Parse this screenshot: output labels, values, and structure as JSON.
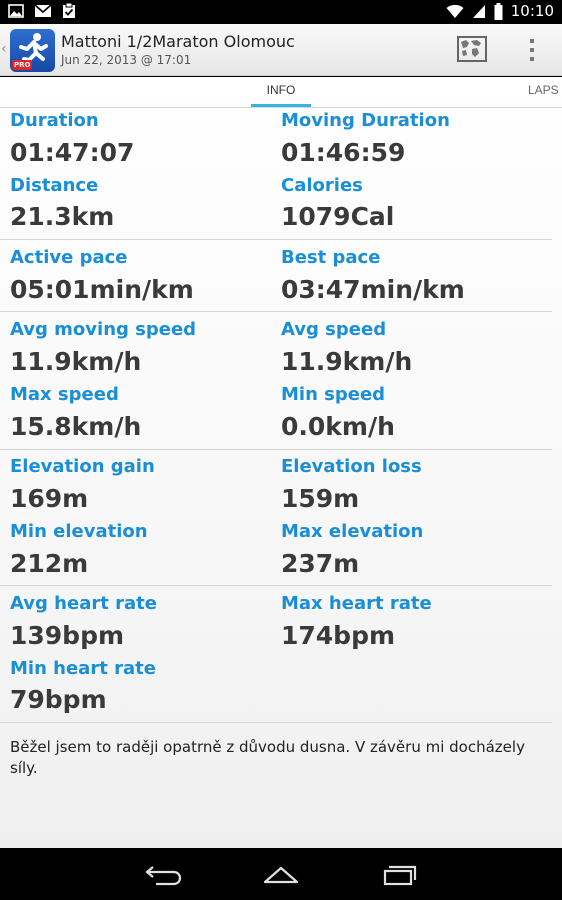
{
  "status_bar": {
    "time": "10:10",
    "left_icons": [
      "image-icon",
      "gmail-icon",
      "clipboard-icon"
    ],
    "right_icons": [
      "wifi-icon",
      "signal-icon",
      "battery-icon"
    ]
  },
  "action_bar": {
    "title": "Mattoni 1/2Maraton Olomouc",
    "subtitle": "Jun 22, 2013 @ 17:01",
    "logo_badge": "PRO",
    "actions": [
      "map-icon",
      "overflow-menu-icon"
    ]
  },
  "tabs": [
    {
      "label": "INFO",
      "selected": true
    },
    {
      "label": "LAPS",
      "selected": false
    }
  ],
  "stats": {
    "duration": {
      "label": "Duration",
      "value": "01:47:07"
    },
    "moving_duration": {
      "label": "Moving Duration",
      "value": "01:46:59"
    },
    "distance": {
      "label": "Distance",
      "value": "21.3km"
    },
    "calories": {
      "label": "Calories",
      "value": "1079Cal"
    },
    "active_pace": {
      "label": "Active pace",
      "value": "05:01min/km"
    },
    "best_pace": {
      "label": "Best pace",
      "value": "03:47min/km"
    },
    "avg_moving_speed": {
      "label": "Avg moving speed",
      "value": "11.9km/h"
    },
    "avg_speed": {
      "label": "Avg speed",
      "value": "11.9km/h"
    },
    "max_speed": {
      "label": "Max speed",
      "value": "15.8km/h"
    },
    "min_speed": {
      "label": "Min speed",
      "value": "0.0km/h"
    },
    "elevation_gain": {
      "label": "Elevation gain",
      "value": "169m"
    },
    "elevation_loss": {
      "label": "Elevation loss",
      "value": "159m"
    },
    "min_elevation": {
      "label": "Min elevation",
      "value": "212m"
    },
    "max_elevation": {
      "label": "Max elevation",
      "value": "237m"
    },
    "avg_heart_rate": {
      "label": "Avg heart rate",
      "value": "139bpm"
    },
    "max_heart_rate": {
      "label": "Max heart rate",
      "value": "174bpm"
    },
    "min_heart_rate": {
      "label": "Min heart rate",
      "value": "79bpm"
    }
  },
  "note": "Běžel jsem to raději opatrně z důvodu dusna. V závěru mi docházely síly.",
  "nav_bar": [
    "back-icon",
    "home-icon",
    "recents-icon"
  ],
  "colors": {
    "label_blue": "#1a8fd6",
    "value_gray": "#3a3a3a",
    "tab_indicator": "#33b5e5"
  }
}
